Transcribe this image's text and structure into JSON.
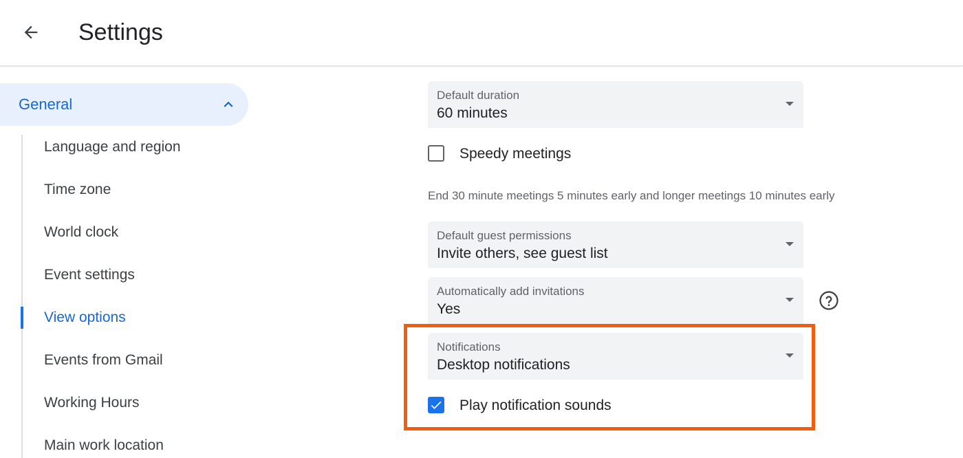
{
  "header": {
    "title": "Settings",
    "back_icon": "arrow-back-icon"
  },
  "sidebar": {
    "section": {
      "label": "General",
      "expanded": true,
      "icon": "chevron-up-icon"
    },
    "items": [
      {
        "label": "Language and region",
        "active": false
      },
      {
        "label": "Time zone",
        "active": false
      },
      {
        "label": "World clock",
        "active": false
      },
      {
        "label": "Event settings",
        "active": false
      },
      {
        "label": "View options",
        "active": true
      },
      {
        "label": "Events from Gmail",
        "active": false
      },
      {
        "label": "Working Hours",
        "active": false
      },
      {
        "label": "Main work location",
        "active": false
      }
    ]
  },
  "main": {
    "default_duration": {
      "label": "Default duration",
      "value": "60 minutes"
    },
    "speedy_meetings": {
      "label": "Speedy meetings",
      "checked": false,
      "helper": "End 30 minute meetings 5 minutes early and longer meetings 10 minutes early"
    },
    "guest_permissions": {
      "label": "Default guest permissions",
      "value": "Invite others, see guest list"
    },
    "auto_invitations": {
      "label": "Automatically add invitations",
      "value": "Yes",
      "help_icon": "help-circle-icon"
    },
    "notifications": {
      "label": "Notifications",
      "value": "Desktop notifications"
    },
    "notification_sounds": {
      "label": "Play notification sounds",
      "checked": true
    }
  },
  "colors": {
    "accent": "#1a73e8",
    "active_text": "#1967d2",
    "active_bg": "#e8f0fe",
    "field_bg": "#f1f3f4",
    "highlight": "#f55d0e"
  }
}
